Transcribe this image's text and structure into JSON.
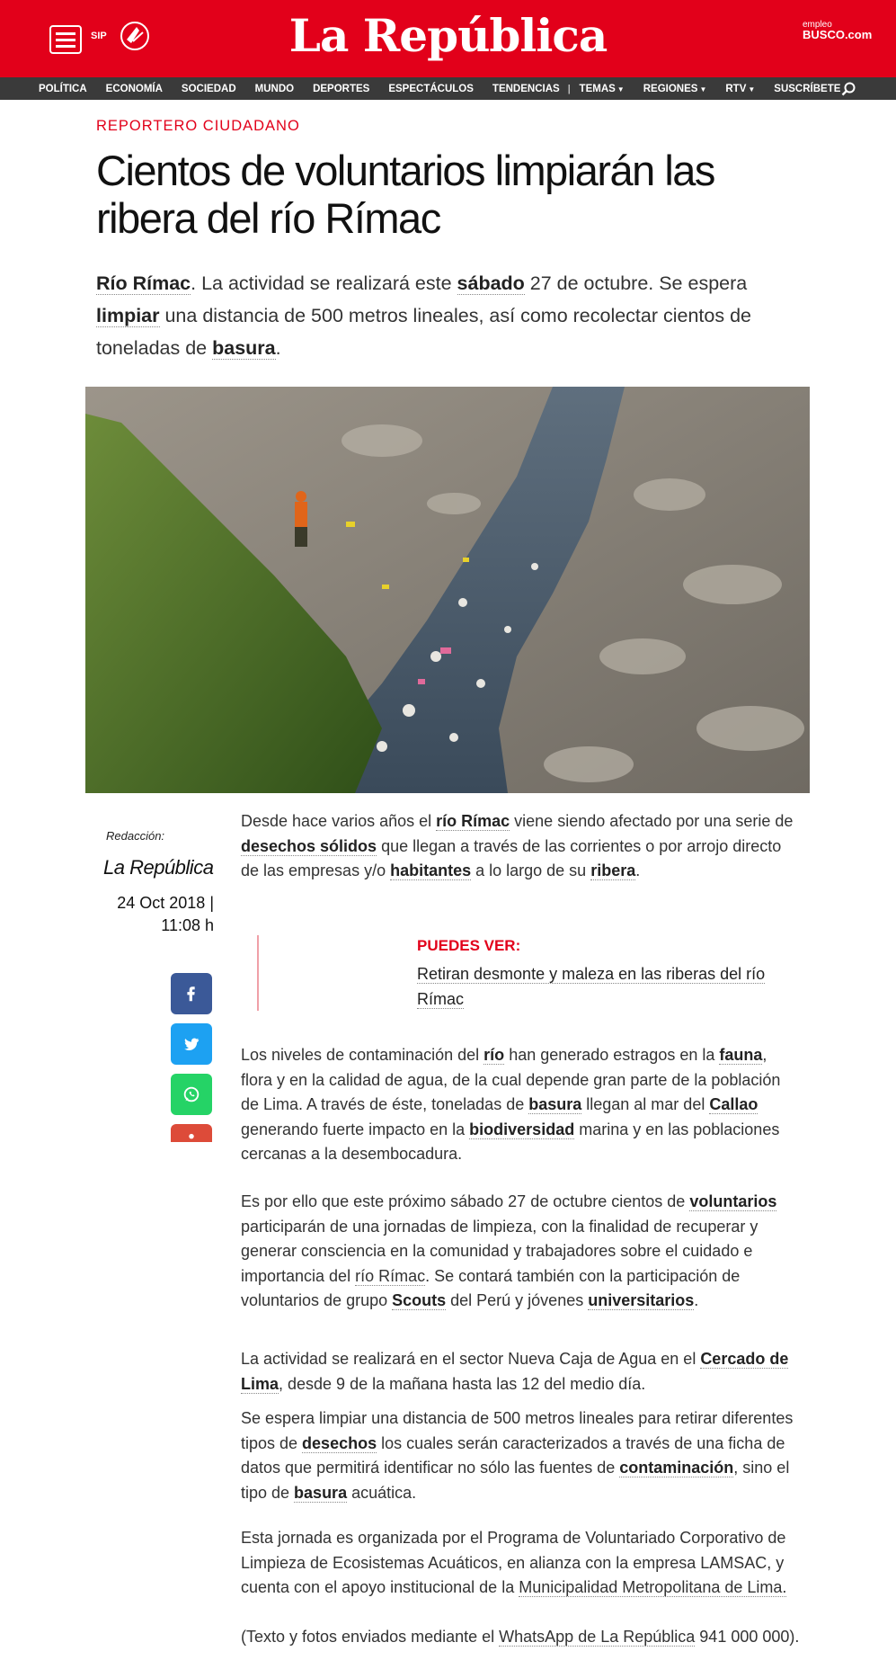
{
  "header": {
    "brand": "La República",
    "sip": "SIP",
    "empleo_small": "empleo",
    "empleo_big": "BUSCO.com"
  },
  "nav": {
    "items": [
      "POLÍTICA",
      "ECONOMÍA",
      "SOCIEDAD",
      "MUNDO",
      "DEPORTES",
      "ESPECTÁCULOS",
      "TENDENCIAS"
    ],
    "separator": "|",
    "dropdowns": [
      "TEMAS",
      "REGIONES",
      "RTV"
    ],
    "subscribe": "SUSCRÍBETE"
  },
  "article": {
    "section": "REPORTERO CIUDADANO",
    "headline": "Cientos de voluntarios limpiarán las ribera del río Rímac",
    "summary": {
      "k1": "Río Rímac",
      "t1": ". La actividad se realizará este ",
      "k2": "sábado",
      "t2": " 27 de octubre. Se espera ",
      "k3": "limpiar",
      "t3": " una distancia de 500 metros lineales, así como recolectar cientos de toneladas de ",
      "k4": "basura",
      "t4": "."
    },
    "byline": {
      "label": "Redacción:",
      "name": "La República",
      "date": "24 Oct 2018 |",
      "time": "11:08 h"
    },
    "related": {
      "label": "PUEDES VER:",
      "link": "Retiran desmonte y maleza en las riberas del río Rímac"
    },
    "p1": {
      "t1": "Desde hace varios años el ",
      "k1": "río Rímac",
      "t2": " viene siendo afectado por una serie de ",
      "k2": "desechos sólidos",
      "t3": " que llegan a través de las corrientes o por arrojo directo de las empresas y/o ",
      "k3": "habitantes",
      "t4": " a lo largo de su ",
      "k4": "ribera",
      "t5": "."
    },
    "p2": {
      "t1": "Los niveles de contaminación del ",
      "k1": "río",
      "t2": " han generado estragos en la ",
      "k2": "fauna",
      "t3": ", flora y en la calidad de agua, de la cual depende gran parte de la población de Lima. A través de éste, toneladas de ",
      "k3": "basura",
      "t4": " llegan al mar del ",
      "k4": "Callao",
      "t5": " generando fuerte impacto en la ",
      "k5": "biodiversidad",
      "t6": " marina y en las poblaciones cercanas a la desembocadura."
    },
    "p3": {
      "t1": "Es por ello que este próximo sábado 27 de octubre cientos de ",
      "k1": "voluntarios",
      "t2": " participarán de una jornadas de limpieza, con la finalidad de recuperar y generar consciencia en la comunidad y trabajadores sobre el cuidado e importancia del ",
      "l1": "río Rímac",
      "t3": ". Se contará también con la participación de voluntarios de grupo ",
      "k2": "Scouts",
      "t4": " del Perú y jóvenes ",
      "k3": "universitarios",
      "t5": "."
    },
    "p4": {
      "t1": "La actividad se realizará en el sector Nueva Caja de Agua en el ",
      "k1": "Cercado de Lima",
      "t2": ", desde 9 de la mañana hasta las 12 del medio día."
    },
    "p5": {
      "t1": "Se espera limpiar una distancia de 500 metros lineales para retirar diferentes tipos de ",
      "k1": "desechos",
      "t2": " los cuales serán caracterizados a través de una ficha de datos que permitirá identificar no sólo las fuentes de ",
      "k2": "contaminación",
      "t3": ", sino el tipo de ",
      "k3": "basura",
      "t4": " acuática."
    },
    "p6": {
      "t1": "Esta jornada es organizada por el Programa de Voluntariado Corporativo de Limpieza de Ecosistemas Acuáticos, en alianza con la empresa LAMSAC, y cuenta con el apoyo institucional de la ",
      "l1": "Municipalidad Metropolitana de Lima.",
      "t2": ""
    },
    "p7": {
      "t1": "(Texto y fotos enviados mediante el ",
      "l1": "WhatsApp de La República",
      "t2": " 941 000 000)."
    }
  },
  "share": [
    "facebook-icon",
    "twitter-icon",
    "whatsapp-icon",
    "google-plus-icon"
  ],
  "colors": {
    "brand_red": "#e2001a",
    "nav_bg": "#3a3a3a",
    "facebook": "#3b5998",
    "twitter": "#1da1f2",
    "whatsapp": "#25d366"
  }
}
